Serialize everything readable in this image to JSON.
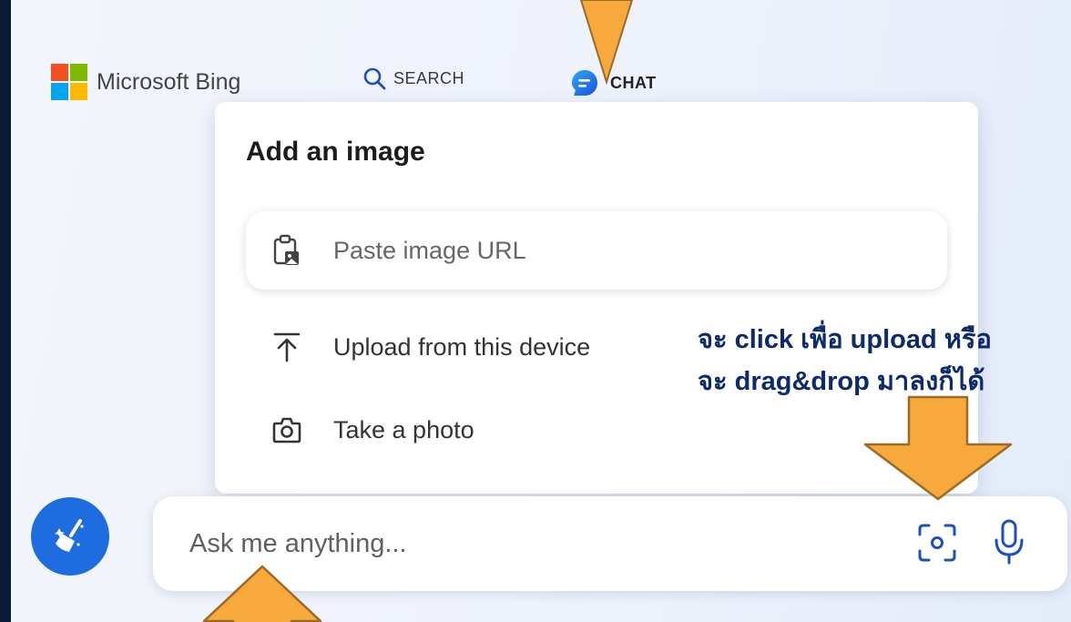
{
  "header": {
    "brand_name": "Microsoft Bing",
    "brand_colors": [
      "#f25022",
      "#7fba00",
      "#00a4ef",
      "#ffb900"
    ],
    "tabs": [
      {
        "label": "SEARCH",
        "icon": "search-icon",
        "selected": false
      },
      {
        "label": "CHAT",
        "icon": "chat-bubble-icon",
        "selected": true
      }
    ]
  },
  "popover": {
    "title": "Add an image",
    "url_input": {
      "placeholder": "Paste image URL",
      "icon": "paste-image-icon"
    },
    "items": [
      {
        "label": "Upload from this device",
        "icon": "upload-icon"
      },
      {
        "label": "Take a photo",
        "icon": "camera-icon"
      }
    ]
  },
  "composer": {
    "placeholder": "Ask me anything...",
    "new_topic_icon": "broom-icon",
    "visual_search_icon": "visual-search-icon",
    "mic_icon": "microphone-icon"
  },
  "annotation": {
    "line1": "จะ click เพื่อ upload หรือ",
    "line2": "จะ drag&drop มาลงก็ได้",
    "arrow_color": "#f7a93c"
  },
  "colors": {
    "accent": "#1f4fbf",
    "broom_button": "#1d6ce0",
    "annotation_text": "#0d2a6e"
  }
}
